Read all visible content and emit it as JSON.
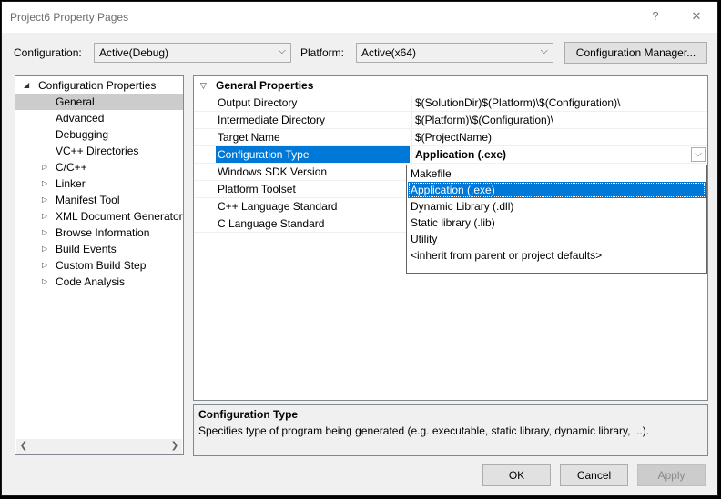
{
  "window": {
    "title": "Project6 Property Pages",
    "help_label": "?",
    "close_label": "✕"
  },
  "toolbar": {
    "configuration_label": "Configuration:",
    "configuration_value": "Active(Debug)",
    "platform_label": "Platform:",
    "platform_value": "Active(x64)",
    "config_manager_label": "Configuration Manager..."
  },
  "tree": {
    "root": "Configuration Properties",
    "items": [
      {
        "label": "General",
        "selected": true
      },
      {
        "label": "Advanced"
      },
      {
        "label": "Debugging"
      },
      {
        "label": "VC++ Directories"
      },
      {
        "label": "C/C++",
        "expandable": true
      },
      {
        "label": "Linker",
        "expandable": true
      },
      {
        "label": "Manifest Tool",
        "expandable": true
      },
      {
        "label": "XML Document Generator",
        "expandable": true
      },
      {
        "label": "Browse Information",
        "expandable": true
      },
      {
        "label": "Build Events",
        "expandable": true
      },
      {
        "label": "Custom Build Step",
        "expandable": true
      },
      {
        "label": "Code Analysis",
        "expandable": true
      }
    ]
  },
  "grid": {
    "section_title": "General Properties",
    "rows": [
      {
        "name": "Output Directory",
        "value": "$(SolutionDir)$(Platform)\\$(Configuration)\\"
      },
      {
        "name": "Intermediate Directory",
        "value": "$(Platform)\\$(Configuration)\\"
      },
      {
        "name": "Target Name",
        "value": "$(ProjectName)"
      },
      {
        "name": "Configuration Type",
        "value": "Application (.exe)"
      },
      {
        "name": "Windows SDK Version",
        "value": ""
      },
      {
        "name": "Platform Toolset",
        "value": ""
      },
      {
        "name": "C++ Language Standard",
        "value": ""
      },
      {
        "name": "C Language Standard",
        "value": ""
      }
    ]
  },
  "dropdown": {
    "options": [
      "Makefile",
      "Application (.exe)",
      "Dynamic Library (.dll)",
      "Static library (.lib)",
      "Utility",
      "<inherit from parent or project defaults>"
    ],
    "highlighted": "Application (.exe)"
  },
  "description": {
    "title": "Configuration Type",
    "text": "Specifies type of program being generated (e.g. executable, static library, dynamic library, ...)."
  },
  "buttons": {
    "ok": "OK",
    "cancel": "Cancel",
    "apply": "Apply"
  },
  "colors": {
    "selection_blue": "#0078d7",
    "tree_selected": "#cccccc"
  },
  "icons": {
    "expand_collapsed": "triangle-right",
    "expand_open": "triangle-down",
    "combo_arrow": "chevron-down"
  }
}
